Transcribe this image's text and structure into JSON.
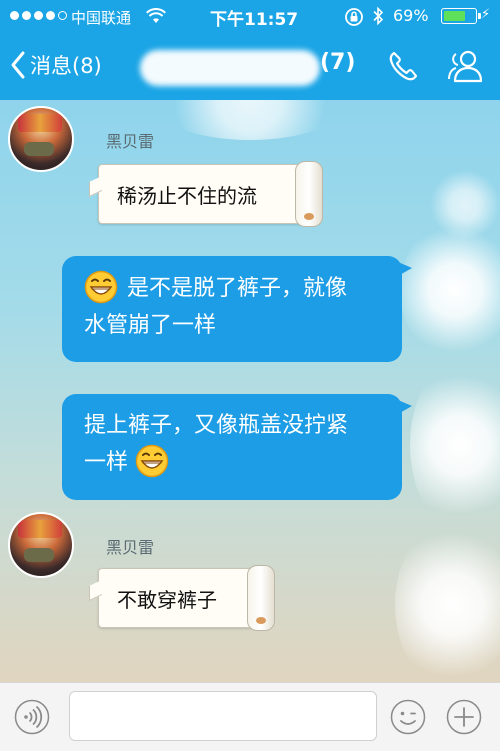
{
  "status_bar": {
    "carrier": "中国联通",
    "time": "下午11:57",
    "battery_percent_text": "69%",
    "battery_level": 0.69,
    "signal_bars_filled": 4,
    "signal_bars_total": 5
  },
  "nav": {
    "back_label": "消息(8)",
    "title_count": "(7)",
    "icons": [
      "chevron-left-icon",
      "phone-icon",
      "contacts-icon"
    ]
  },
  "messages": [
    {
      "side": "left",
      "sender": "黑贝雷",
      "text": "稀汤止不住的流",
      "style": "scroll"
    },
    {
      "side": "right",
      "text": "是不是脱了裤子，就像水管崩了一样",
      "emoji": "grin-emoji",
      "emoji_position": "start"
    },
    {
      "side": "right",
      "text": "提上裤子，又像瓶盖没拧紧一样",
      "emoji": "grin-emoji",
      "emoji_position": "end"
    },
    {
      "side": "left",
      "sender": "黑贝雷",
      "text": "不敢穿裤子",
      "style": "scroll"
    }
  ],
  "msg2": {
    "line1": "是不是脱了裤子，就像",
    "line2": "水管崩了一样"
  },
  "msg3": {
    "line1": "提上裤子，又像瓶盖没拧紧",
    "line2": "一样"
  },
  "input_bar": {
    "placeholder": "",
    "value": "",
    "icons": [
      "voice-icon",
      "emoji-face-icon",
      "plus-icon"
    ]
  },
  "colors": {
    "header_bg": "#1ba5e6",
    "bubble_blue": "#1d9de6",
    "battery_green": "#5ee05a"
  }
}
